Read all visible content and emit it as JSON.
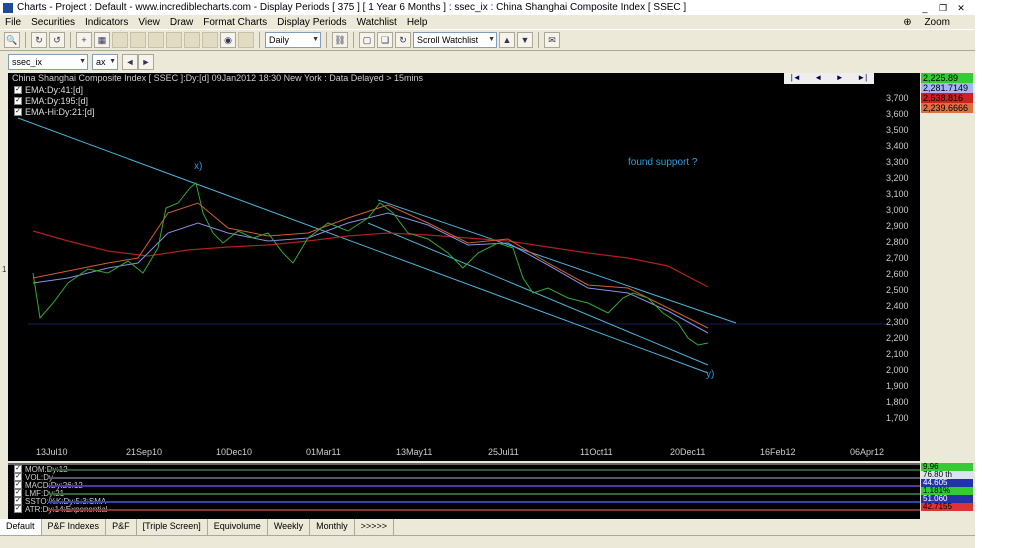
{
  "window": {
    "title": "Charts - Project : Default - www.incrediblecharts.com - Display Periods  [ 375 ]  [ 1 Year 6 Months ] : ssec_ix : China Shanghai Composite Index  [ SSEC ]"
  },
  "menu": {
    "items": [
      "File",
      "Securities",
      "Indicators",
      "View",
      "Draw",
      "Format Charts",
      "Display Periods",
      "Watchlist",
      "Help"
    ],
    "zoom": "Zoom"
  },
  "toolbar": {
    "period": "Daily",
    "watchlist": "Scroll Watchlist"
  },
  "symbol": {
    "value": "ssec_ix",
    "exchange": "ax"
  },
  "chart": {
    "info": "China Shanghai Composite Index  [ SSEC ]:Dy:[d]  09Jan2012 18:30 New York : Data Delayed > 15mins",
    "legend": [
      "EMA:Dy:41:[d]",
      "EMA:Dy:195:[d]",
      "EMA-Hi:Dy:21:[d]"
    ],
    "nav": [
      "|◄",
      "◄",
      "►",
      "►|"
    ],
    "annotation_x": "x)",
    "annotation_y": "y)",
    "annotation_support": "found support ?",
    "left_tick": "1",
    "y_ticks": [
      "3,700",
      "3,600",
      "3,500",
      "3,400",
      "3,300",
      "3,200",
      "3,100",
      "3,000",
      "2,900",
      "2,800",
      "2,700",
      "2,600",
      "2,500",
      "2,400",
      "2,300",
      "2,200",
      "2,100",
      "2,000",
      "1,900",
      "1,800",
      "1,700"
    ],
    "x_ticks": [
      "13Jul10",
      "21Sep10",
      "10Dec10",
      "01Mar11",
      "13May11",
      "25Jul11",
      "11Oct11",
      "20Dec11",
      "16Feb12",
      "06Apr12"
    ],
    "values": [
      {
        "text": "2,225.89",
        "bg": "#33cc33"
      },
      {
        "text": "2,281.7149",
        "bg": "#aab4f0"
      },
      {
        "text": "2,538.816",
        "bg": "#cc2222"
      },
      {
        "text": "2,239.6666",
        "bg": "#e07040"
      }
    ]
  },
  "indicators": {
    "names": [
      "MOM:Dy:12",
      "VOL:Dy",
      "MACD:Dy:26:12",
      "LMF:Dy:21",
      "SSTO:%K:Dy:5:3:SMA",
      "ATR:Dy:14:Exponential"
    ],
    "values": [
      {
        "text": "9.96",
        "bg": "#33cc33"
      },
      {
        "text": "76.80 th",
        "bg": "#dde4f0"
      },
      {
        "text": "44.605",
        "bg": "#2233aa"
      },
      {
        "text": "1.181%",
        "bg": "#33cc33"
      },
      {
        "text": "51.060",
        "bg": "#2233aa"
      },
      {
        "text": "42.7155",
        "bg": "#dd3333"
      }
    ]
  },
  "tabs": [
    "Default",
    "P&F Indexes",
    "P&F",
    "[Triple Screen]",
    "Equivolume",
    "Weekly",
    "Monthly",
    ">>>>>"
  ]
}
